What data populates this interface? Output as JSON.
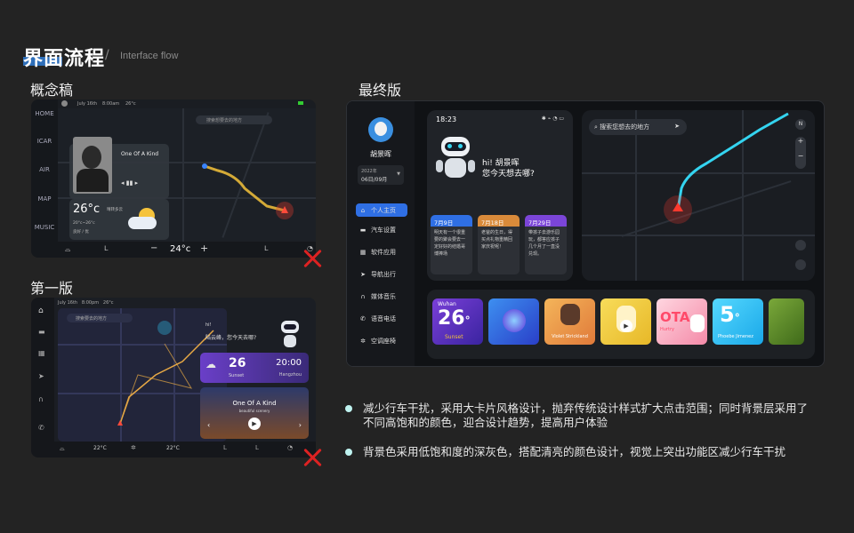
{
  "header": {
    "title": "界面流程",
    "separator": "/",
    "subtitle": "Interface flow"
  },
  "sections": {
    "concept": "概念稿",
    "first": "第一版",
    "final": "最终版"
  },
  "concept": {
    "top_date": "July 16th",
    "top_time": "8:00am",
    "top_temp": "26°c",
    "search_placeholder": "搜索想要去的地方",
    "nav": [
      "HOME",
      "ICAR",
      "AIR",
      "MAP",
      "MUSIC"
    ],
    "music_title": "One Of A Kind",
    "weather_temp": "26°c",
    "weather_info": "晴转多云",
    "weather_range": "20°c~26°c",
    "weather_aqi": "良好 / 优",
    "ac_temp": "24°c",
    "ac_minus": "−",
    "ac_plus": "+"
  },
  "first": {
    "top_date": "July 16th",
    "top_time": "8:00pm",
    "top_temp": "26°c",
    "search_placeholder": "搜索要去的地方",
    "greeting1": "hi!",
    "greeting2": "陆云峰，您今天去哪?",
    "weather_temp": "26",
    "weather_label": "Sunset",
    "clock": "20:00",
    "city": "Hangzhou",
    "music_title": "One Of A Kind",
    "music_sub": "beautiful scenery",
    "left_temp": "22°C",
    "right_temp": "22°C"
  },
  "final": {
    "username": "胡景晖",
    "year": "2022年",
    "date": "06日/09月",
    "menu": [
      {
        "label": "个人主页",
        "icon": "⌂"
      },
      {
        "label": "汽车设置",
        "icon": "▬"
      },
      {
        "label": "软件应用",
        "icon": "▦"
      },
      {
        "label": "导航出行",
        "icon": "➤"
      },
      {
        "label": "媒体音乐",
        "icon": "∩"
      },
      {
        "label": "语音电话",
        "icon": "✆"
      },
      {
        "label": "空调座椅",
        "icon": "✲"
      }
    ],
    "phone_time": "18:23",
    "phone_status": "✱ ⌁ ◔ ▭",
    "greeting1": "hi! 胡景晖",
    "greeting2": "您今天想去哪?",
    "memos": [
      {
        "date": "7月9日",
        "color": "#2f6fe4",
        "text": "明天有一个很重要的聚会要去一定好好的结婚哥博捧场"
      },
      {
        "date": "7月18日",
        "color": "#d98a3a",
        "text": "老爸的生日，得买点礼物重精回家庆祝呢！"
      },
      {
        "date": "7月29日",
        "color": "#7b45d8",
        "text": "带孩子去游乐园玩，都答应孩子几个月了一直没兑现。"
      }
    ],
    "map_search": "搜索您想去的地方",
    "map_compass": "N",
    "map_zoom_in": "+",
    "map_zoom_out": "−",
    "apps": [
      {
        "top": "Wuhan",
        "big": "26",
        "deg": "°",
        "bottom": "Sunset",
        "bg": "#5a2fb8"
      },
      {
        "top": "",
        "big": "",
        "deg": "",
        "bottom": "",
        "bg": "#2f6fe4"
      },
      {
        "top": "",
        "big": "",
        "deg": "",
        "bottom": "Violet Strickland",
        "bg": "#e7a24a"
      },
      {
        "top": "",
        "big": "",
        "deg": "",
        "bottom": "",
        "bg": "#f0cf38"
      },
      {
        "top": "",
        "big": "OTA",
        "deg": "",
        "bottom": "Hurtry",
        "bg": "#f4a0b4"
      },
      {
        "top": "",
        "big": "5",
        "deg": "°",
        "bottom": "Phoebe Jimenez",
        "bg": "#2ec0ef"
      },
      {
        "top": "",
        "big": "",
        "deg": "",
        "bottom": "",
        "bg": "#5f8a2a"
      }
    ]
  },
  "bullets": [
    "减少行车干扰，采用大卡片风格设计，抛弃传统设计样式扩大点击范围；同时背景层采用了不同高饱和的颜色，迎合设计趋势，提高用户体验",
    "背景色采用低饱和度的深灰色，搭配清亮的颜色设计，视觉上突出功能区减少行车干扰"
  ],
  "colors": {
    "accent": "#2f6fe4",
    "route_concept": "#f5c33b",
    "route_final": "#34d4f0",
    "bullet": "#bff3f0",
    "reject": "#dd2222"
  }
}
